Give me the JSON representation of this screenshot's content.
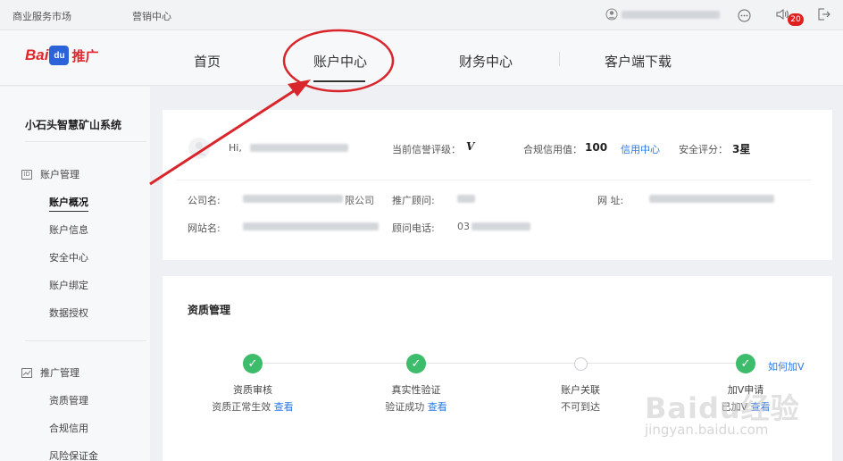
{
  "topbar": {
    "link_market": "商业服务市场",
    "link_marketing": "营销中心",
    "notification_count": "20"
  },
  "brand": {
    "logo_bai": "Bai",
    "logo_du": "du",
    "logo_suffix": "推广"
  },
  "nav": {
    "items": [
      {
        "label": "首页"
      },
      {
        "label": "账户中心"
      },
      {
        "label": "财务中心"
      },
      {
        "label": "客户端下载"
      }
    ],
    "active_index": 1
  },
  "sidebar": {
    "system_name": "小石头智慧矿山系统",
    "group1": {
      "label": "账户管理",
      "items": [
        "账户概况",
        "账户信息",
        "安全中心",
        "账户绑定",
        "数据授权"
      ]
    },
    "group2": {
      "label": "推广管理",
      "items": [
        "资质管理",
        "合规信用",
        "风险保证金"
      ]
    }
  },
  "account": {
    "greeting": "Hi,",
    "credit_label": "当前信誉评级：",
    "credit_value": "V",
    "compliance_label": "合规信用值：",
    "compliance_value": "100",
    "credit_center_link": "信用中心",
    "security_label": "安全评分：",
    "security_value": "3星",
    "company_label": "公司名:",
    "company_suffix": "限公司",
    "advisor_label": "推广顾问:",
    "website_label": "网  址:",
    "site_label": "网站名:",
    "advisor_phone_label": "顾问电话:",
    "advisor_phone_prefix": "03"
  },
  "qualification": {
    "title": "资质管理",
    "steps": [
      {
        "name": "资质审核",
        "status": "资质正常生效",
        "link": "查看",
        "done": true
      },
      {
        "name": "真实性验证",
        "status": "验证成功",
        "link": "查看",
        "done": true
      },
      {
        "name": "账户关联",
        "status": "不可到达",
        "link": "",
        "done": false
      },
      {
        "name": "加V申请",
        "status": "已加V",
        "link": "查看",
        "done": true
      }
    ],
    "howto_link": "如何加V"
  },
  "watermark": {
    "brand": "Baidu经验",
    "url": "jingyan.baidu.com"
  },
  "colors": {
    "accent": "#2b78e4",
    "success": "#3dbd6b",
    "brand_red": "#e3262b",
    "annotation_red": "#d9262c"
  }
}
